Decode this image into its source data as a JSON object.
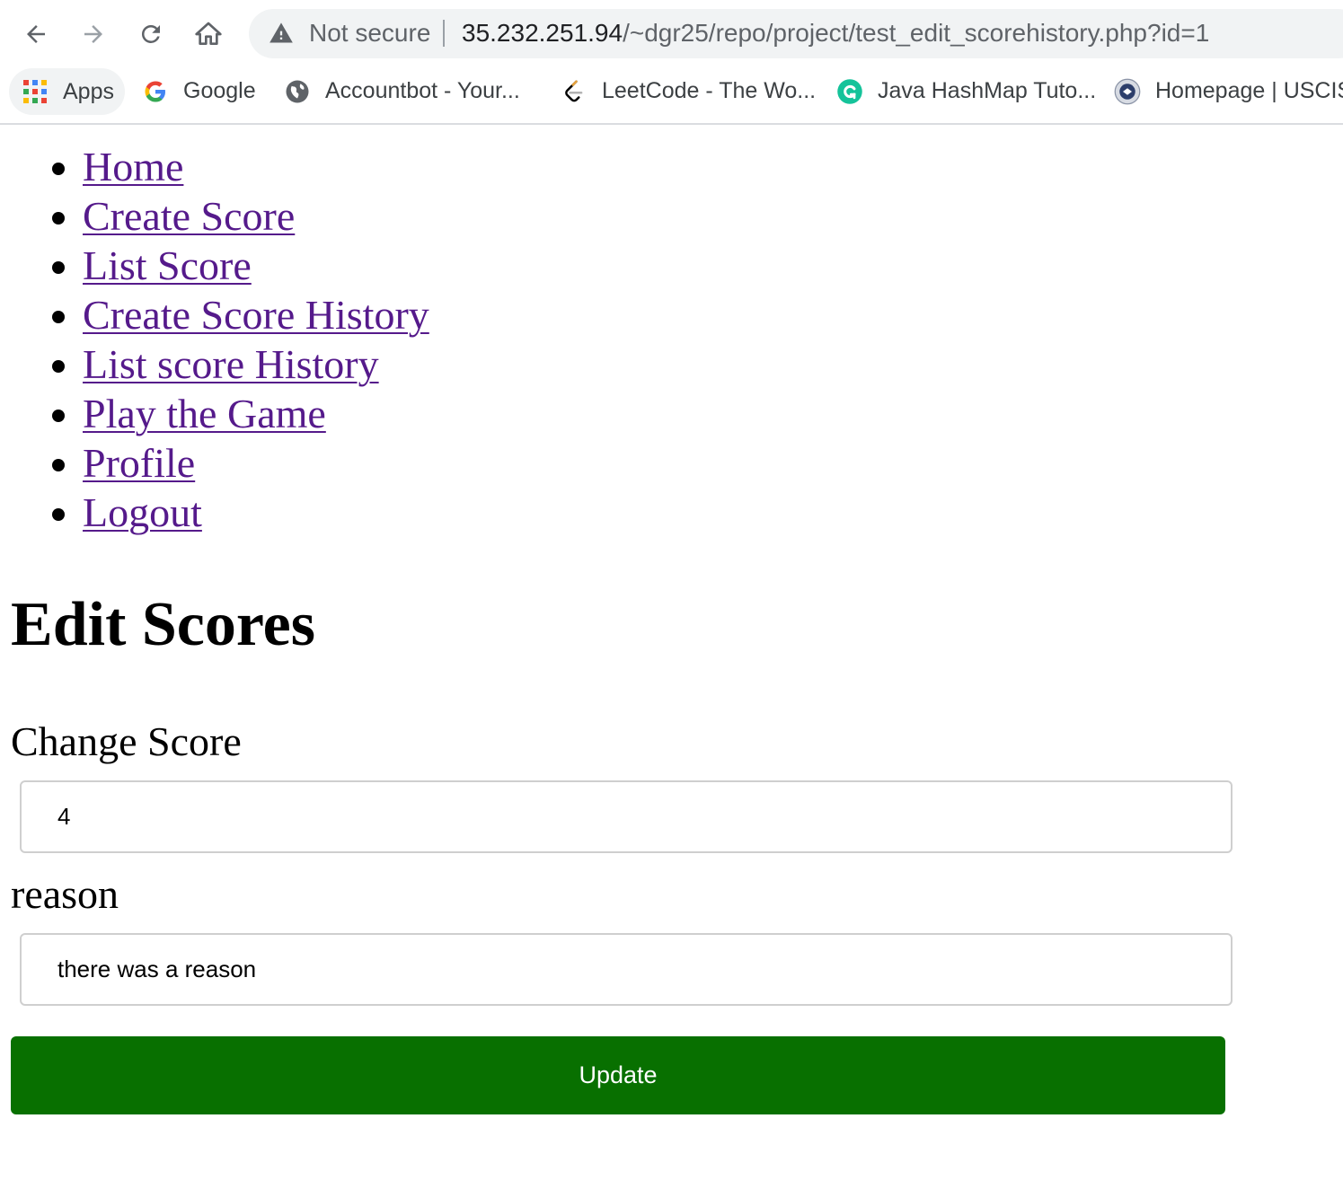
{
  "browser": {
    "security_label": "Not secure",
    "url_host": "35.232.251.94",
    "url_path": "/~dgr25/repo/project/test_edit_scorehistory.php?id=1",
    "icons": [
      "back-arrow-icon",
      "forward-arrow-icon",
      "reload-icon",
      "home-icon",
      "warning-icon"
    ]
  },
  "bookmarks": [
    {
      "label": "Apps",
      "icon": "apps-grid-icon"
    },
    {
      "label": "Google",
      "icon": "google-icon"
    },
    {
      "label": "Accountbot - Your...",
      "icon": "globe-icon"
    },
    {
      "label": "LeetCode - The Wo...",
      "icon": "leetcode-icon"
    },
    {
      "label": "Java HashMap Tuto...",
      "icon": "grammarly-icon"
    },
    {
      "label": "Homepage | USCIS",
      "icon": "uscis-seal-icon"
    }
  ],
  "nav": [
    {
      "label": "Home"
    },
    {
      "label": "Create Score"
    },
    {
      "label": "List Score"
    },
    {
      "label": "Create Score History"
    },
    {
      "label": "List score History"
    },
    {
      "label": "Play the Game"
    },
    {
      "label": "Profile"
    },
    {
      "label": "Logout"
    }
  ],
  "page": {
    "title": "Edit Scores"
  },
  "form": {
    "score_label": "Change Score",
    "score_value": "4",
    "reason_label": "reason",
    "reason_value": "there was a reason",
    "submit_label": "Update"
  },
  "colors": {
    "link": "#551a8b",
    "button": "#087000",
    "button_text": "#ffffff"
  }
}
